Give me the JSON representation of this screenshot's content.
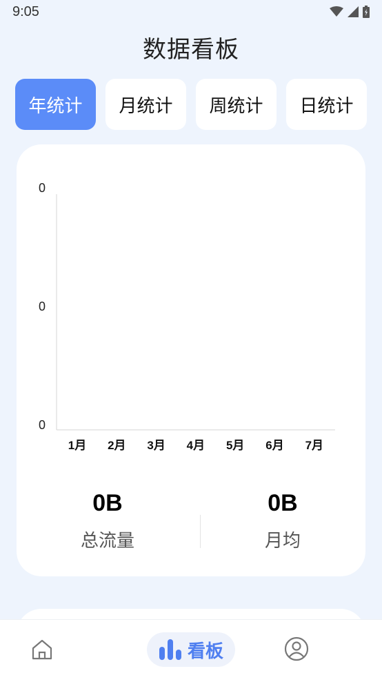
{
  "status": {
    "time": "9:05"
  },
  "header": {
    "title": "数据看板"
  },
  "tabs": [
    {
      "label": "年统计",
      "active": true
    },
    {
      "label": "月统计",
      "active": false
    },
    {
      "label": "周统计",
      "active": false
    },
    {
      "label": "日统计",
      "active": false
    }
  ],
  "chart_data": {
    "type": "bar",
    "categories": [
      "1月",
      "2月",
      "3月",
      "4月",
      "5月",
      "6月",
      "7月"
    ],
    "values": [
      0,
      0,
      0,
      0,
      0,
      0,
      0
    ],
    "y_tick_labels": [
      "0",
      "0",
      "0"
    ],
    "ylim": [
      0,
      0
    ],
    "grid": false,
    "title": "",
    "xlabel": "",
    "ylabel": ""
  },
  "summary": {
    "total": {
      "value": "0B",
      "label": "总流量"
    },
    "monthly": {
      "value": "0B",
      "label": "月均"
    }
  },
  "bottom_nav": {
    "items": [
      {
        "icon": "home-icon",
        "label": ""
      },
      {
        "icon": "bar-chart-icon",
        "label": "看板",
        "active": true
      },
      {
        "icon": "user-icon",
        "label": ""
      }
    ]
  },
  "colors": {
    "accent": "#5b8cf8",
    "nav_active": "#4f7ff0",
    "background": "#eef4fd"
  }
}
